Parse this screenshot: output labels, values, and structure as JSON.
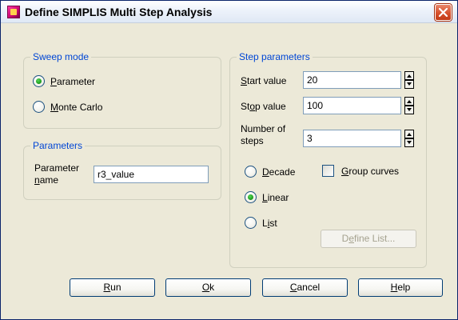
{
  "window": {
    "title": "Define SIMPLIS Multi Step Analysis",
    "icon": "simplis-app-icon",
    "close_icon": "close-icon"
  },
  "sweep_mode": {
    "title": "Sweep mode",
    "options": [
      {
        "label": "Parameter",
        "selected": true
      },
      {
        "label": "Monte Carlo",
        "selected": false
      }
    ]
  },
  "parameters": {
    "title": "Parameters",
    "name_label_line1": "Parameter",
    "name_label_line2": "name",
    "name_value": "r3_value"
  },
  "step_parameters": {
    "title": "Step parameters",
    "start_label": "Start value",
    "start_value": "20",
    "stop_label": "Stop value",
    "stop_value": "100",
    "steps_label_line1": "Number of",
    "steps_label_line2": "steps",
    "steps_value": "3",
    "scale_options": [
      {
        "label": "Decade",
        "selected": false
      },
      {
        "label": "Linear",
        "selected": true
      },
      {
        "label": "List",
        "selected": false
      }
    ],
    "group_curves_label": "Group curves",
    "group_curves_checked": false,
    "define_list_label": "Define List..."
  },
  "buttons": {
    "run": "Run",
    "ok": "Ok",
    "cancel": "Cancel",
    "help": "Help"
  }
}
